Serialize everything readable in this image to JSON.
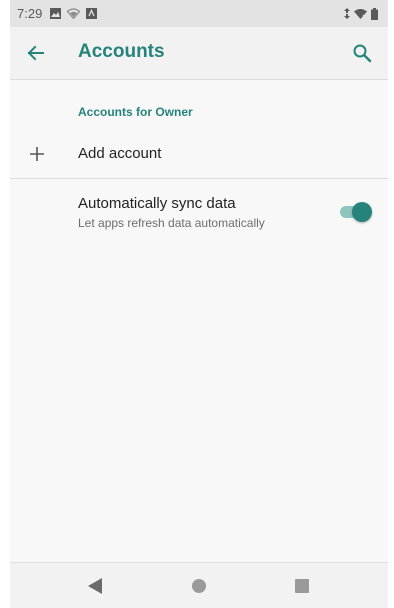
{
  "status_bar": {
    "time": "7:29",
    "notification_icons": [
      "image-icon",
      "wifi-off-icon",
      "app-notification-icon"
    ],
    "right_icons": [
      "data-arrows-icon",
      "wifi-icon",
      "battery-icon"
    ]
  },
  "app_bar": {
    "title": "Accounts",
    "back_icon": "arrow-back-icon",
    "search_icon": "search-icon"
  },
  "section": {
    "header": "Accounts for Owner"
  },
  "add_account": {
    "label": "Add account",
    "icon": "plus-icon"
  },
  "auto_sync": {
    "title": "Automatically sync data",
    "subtitle": "Let apps refresh data automatically",
    "enabled": true
  },
  "nav_bar": {
    "icons": [
      "nav-back-icon",
      "nav-home-icon",
      "nav-recents-icon"
    ]
  },
  "colors": {
    "accent": "#26837b",
    "toggle_track": "#8fc4be",
    "background": "#f8f8f8",
    "status_bar": "#e3e3e3"
  }
}
